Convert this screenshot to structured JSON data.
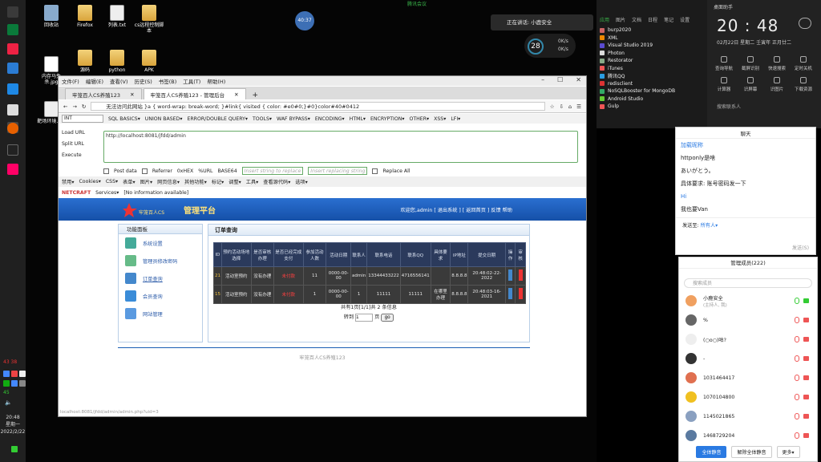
{
  "taskbar": {
    "time": "20:48",
    "weekday": "星期一",
    "date": "2022/2/22",
    "badges": "43 38",
    "badge2": "45"
  },
  "desktop": {
    "icons": [
      "回收站",
      "Firefox",
      "列表.txt",
      "cs远程控制脚本",
      "内存马免杀.jpg",
      "源码",
      "python",
      "APK",
      "靶场环境.jpg",
      "答案"
    ]
  },
  "overlays": {
    "meeting": "腾讯会议",
    "bubble": "40:37",
    "speaking": "正在讲话: 小鹿安全",
    "speed_pct": "28",
    "speed_unit": "%",
    "speed_up": "0K/s",
    "speed_down": "0K/s"
  },
  "browser": {
    "menu": [
      "文件(F)",
      "编辑(E)",
      "查看(V)",
      "历史(S)",
      "书签(B)",
      "工具(T)",
      "帮助(H)"
    ],
    "tabs": [
      "牢笼百人CS养殖123",
      "牢笼百人CS养殖123 - 管理后台"
    ],
    "new_tab": "+",
    "url": "无法访问此网站 }a { word-wrap: break-word; }#link{ visited { color: #e0#0;}#0}color#40#0412",
    "hackbar": {
      "select": "INT",
      "items": [
        "SQL BASICS▾",
        "UNION BASED▾",
        "ERROR/DOUBLE QUERY▾",
        "TOOLS▾",
        "WAF BYPASS▾",
        "ENCODING▾",
        "HTML▾",
        "ENCRYPTION▾",
        "OTHER▾",
        "XSS▾",
        "LFI▾"
      ],
      "load": "Load URL",
      "split": "Split URL",
      "execute": "Execute",
      "url_value": "http://localhost:8081/jfdd/admin",
      "post": "Post data",
      "referrer": "Referrer",
      "hex": "0xHEX",
      "urlenc": "%URL",
      "base64": "BASE64",
      "insert1": "Insert string to replace",
      "insert2": "Insert replacing string",
      "replace_all": "Replace All"
    },
    "addon": [
      "禁用▾",
      "Cookies▾",
      "CSS▾",
      "表单▾",
      "图片▾",
      "网页信息▾",
      "其他功能▾",
      "标记▾",
      "调整▾",
      "工具▾",
      "查看源代码▾",
      "选项▾"
    ],
    "netcraft": "NETCRAFT",
    "services": "Services▾",
    "no_info": "[No information available]",
    "page": {
      "admin_title": "管理平台",
      "logo_text": "牢笼百人CS",
      "header_links": "欢迎您,admin [ 退出系统 ] [ 返回首页 ]  反馈  帮助",
      "sidebar_title": "功能面板",
      "sidebar_items": [
        "系统设置",
        "管理员修改密码",
        "订单查询",
        "会员查询",
        "网站管理"
      ],
      "main_title": "订单查询",
      "headers": [
        "ID",
        "预约活动场地选择",
        "是否审核办理",
        "是否已经完成支付",
        "参加活动人数",
        "活动日期",
        "联系人",
        "联系电话",
        "联系QQ",
        "具体要求",
        "IP地址",
        "提交日期",
        "操作",
        "审核"
      ],
      "rows": [
        [
          "21",
          "活动室预约",
          "没有办理",
          "未付款",
          "11",
          "0000-00-00",
          "admin",
          "13344433222",
          "4716556141",
          "",
          "8.8.8.8",
          "20:48:02-22-2022",
          "",
          ""
        ],
        [
          "15",
          "活动室预约",
          "没有办理",
          "未付款",
          "1",
          "0000-00-00",
          "1",
          "11111",
          "11111",
          "在哪里办理",
          "8.8.8.8",
          "20:48:03-16-2021",
          "",
          ""
        ]
      ],
      "pager": "共有1页[1/1]共 2 条信息",
      "jump_label": "转到",
      "jump_value": "1",
      "jump_suffix": "页",
      "go": "go",
      "footer": "牢笼百人CS养殖123",
      "status": "localhost:8081/jfdd/admin/admin.php?uid=3"
    }
  },
  "launcher": {
    "tabs": [
      "应用",
      "图片",
      "文档",
      "日程",
      "笔记",
      "设置"
    ],
    "apps": [
      "burp2020",
      "XML",
      "Visual Studio 2019",
      "Photon",
      "Restorator",
      "iTunes",
      "腾讯QQ",
      "redisclient",
      "NoSQLBooster for MongoDB",
      "Android Studio",
      "Gulp"
    ]
  },
  "clockpanel": {
    "title": "桌面助手",
    "time": "20 : 48",
    "date": "02月22日  星期二",
    "lunar": "壬寅年 正月廿二",
    "actions": [
      "查询导航",
      "截屏识别",
      "快速搜索",
      "定时关机",
      "计算器",
      "识屏幕",
      "识图片",
      "下载资源"
    ],
    "search_hint": "搜索联系人"
  },
  "chat": {
    "title": "聊天",
    "messages": [
      "加载昵称",
      "httponly是啥",
      "あいがとう。",
      "具体要求: 账号密码发一下",
      "Hi",
      "我也要Van"
    ],
    "sendto": "发送至:",
    "everyone": "所有人▾",
    "send": "发送(S)"
  },
  "members": {
    "title": "管理成员(222)",
    "search": "搜索成员",
    "list": [
      "小鹿安全",
      "%",
      "(○o○)咕?",
      "-",
      "1031464417",
      "1070104800",
      "1145021865",
      "1468729204"
    ],
    "host_note": "(主持人, 我)",
    "btn_mute_all": "全体静音",
    "btn_unmute_all": "解除全体静音",
    "btn_more": "更多▾"
  }
}
